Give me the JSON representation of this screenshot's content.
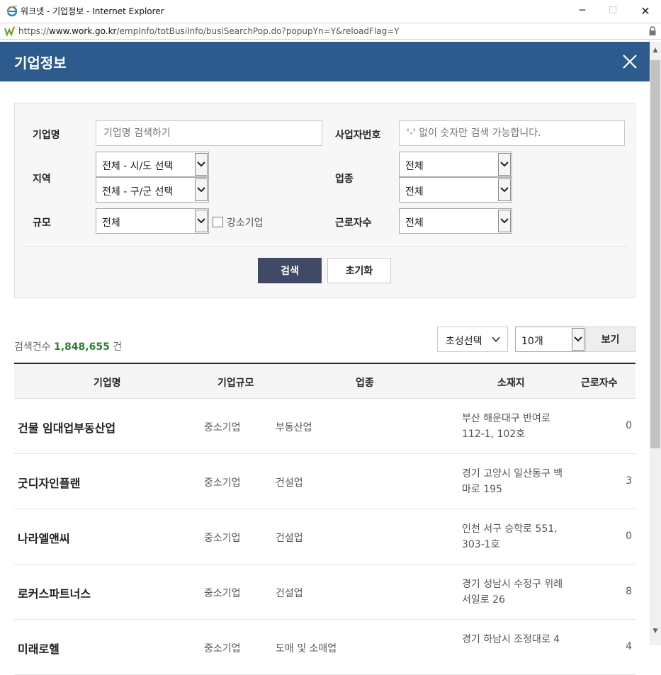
{
  "window": {
    "title": "워크넷 - 기업정보 - Internet Explorer",
    "minimize": "─",
    "maximize": "☐",
    "close": "✕"
  },
  "address": {
    "scheme": "https://",
    "host": "www.work.go.kr",
    "path": "/empInfo/totBusiInfo/busiSearchPop.do?popupYn=Y&reloadFlag=Y"
  },
  "popup": {
    "title": "기업정보"
  },
  "search": {
    "company_label": "기업명",
    "company_placeholder": "기업명 검색하기",
    "bizno_label": "사업자번호",
    "bizno_placeholder": "'-' 없이 숫자만 검색 가능합니다.",
    "region_label": "지역",
    "region_sido": "전체 - 시/도 선택",
    "region_gugun": "전체 - 구/군 선택",
    "industry_label": "업종",
    "industry_1": "전체",
    "industry_2": "전체",
    "scale_label": "규모",
    "scale_value": "전체",
    "strong_label": "강소기업",
    "workers_label": "근로자수",
    "workers_value": "전체",
    "search_btn": "검색",
    "reset_btn": "초기화"
  },
  "results": {
    "count_prefix": "검색건수",
    "count": "1,848,655",
    "count_suffix": "건",
    "initial_select": "초성선택",
    "per_page": "10개",
    "view_btn": "보기"
  },
  "table": {
    "headers": [
      "기업명",
      "기업규모",
      "업종",
      "소재지",
      "근로자수"
    ],
    "rows": [
      {
        "name": "건물 임대업부동산업",
        "size": "중소기업",
        "industry": "부동산업",
        "addr": "부산 해운대구 반여로 112-1, 102호",
        "workers": "0"
      },
      {
        "name": "굿디자인플랜",
        "size": "중소기업",
        "industry": "건설업",
        "addr": "경기 고양시 일산동구 백마로 195",
        "workers": "3"
      },
      {
        "name": "나라엘앤씨",
        "size": "중소기업",
        "industry": "건설업",
        "addr": "인천 서구 승학로 551, 303-1호",
        "workers": "0"
      },
      {
        "name": "로커스파트너스",
        "size": "중소기업",
        "industry": "건설업",
        "addr": "경기 성남시 수정구 위례서일로 26",
        "workers": "8"
      },
      {
        "name": "미래로헬",
        "size": "중소기업",
        "industry": "도매 및 소매업",
        "addr": "경기 하남시 조정대로 4",
        "workers": "4"
      }
    ]
  },
  "colors": {
    "header_blue": "#2d5b8e",
    "search_btn": "#404a66",
    "count_green": "#2e7d32"
  }
}
